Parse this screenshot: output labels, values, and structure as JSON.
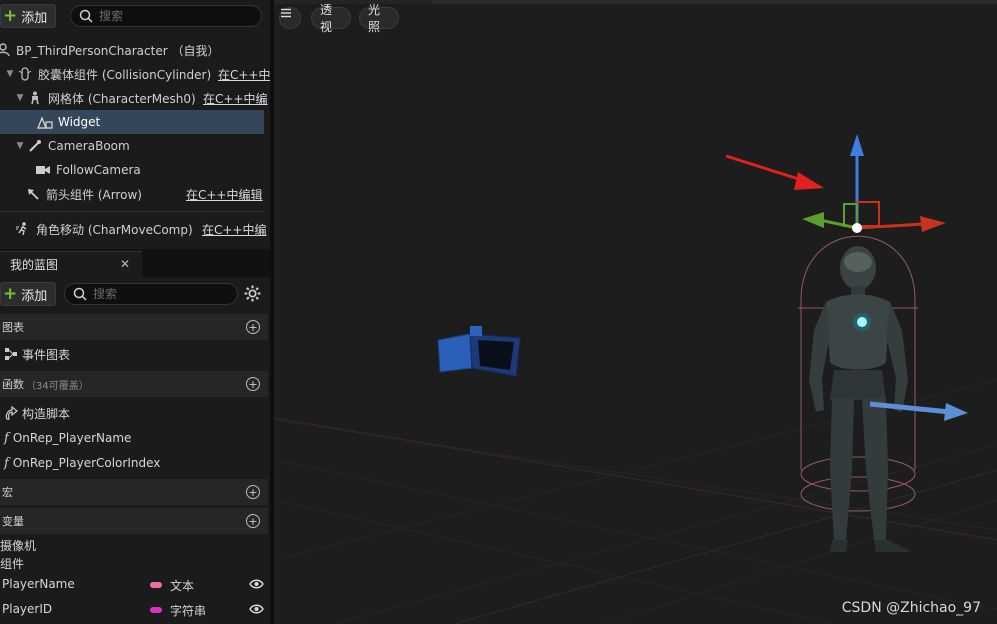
{
  "components_panel": {
    "add_label": "添加",
    "search_placeholder": "搜索",
    "items": [
      {
        "label": "BP_ThirdPersonCharacter （自我）",
        "edit": ""
      },
      {
        "label": "胶囊体组件 (CollisionCylinder)",
        "edit": "在C++中"
      },
      {
        "label": "网格体 (CharacterMesh0)",
        "edit": "在C++中编"
      },
      {
        "label": "Widget",
        "edit": ""
      },
      {
        "label": "CameraBoom",
        "edit": ""
      },
      {
        "label": "FollowCamera",
        "edit": ""
      },
      {
        "label": "箭头组件 (Arrow)",
        "edit": "在C++中编辑"
      },
      {
        "label": "角色移动 (CharMoveComp)",
        "edit": "在C++中编"
      }
    ]
  },
  "my_blueprint": {
    "tab_label": "我的蓝图",
    "add_label": "添加",
    "search_placeholder": "搜索",
    "sections": {
      "graphs": "图表",
      "event_graph": "事件图表",
      "functions": "函数",
      "functions_sub": "（34可覆盖）",
      "construction_script": "构造脚本",
      "func_1": "OnRep_PlayerName",
      "func_2": "OnRep_PlayerColorIndex",
      "macros": "宏",
      "variables": "变量",
      "camera_category": "摄像机",
      "components_category": "组件"
    },
    "variables": [
      {
        "name": "PlayerName",
        "type": "文本",
        "color": "#e86fa8"
      },
      {
        "name": "PlayerID",
        "type": "字符串",
        "color": "#e22cc8"
      }
    ]
  },
  "viewport": {
    "menu_icon": "hamburger-icon",
    "perspective_label": "透视",
    "lighting_label": "光照",
    "watermark": "CSDN @Zhichao_97"
  },
  "colors": {
    "selection": "#34465a",
    "accent_green": "#7bc043",
    "gizmo_x": "#c8321e",
    "gizmo_y": "#5aa02a",
    "gizmo_z": "#3c7fe0",
    "arrow_annotation": "#e22020"
  }
}
